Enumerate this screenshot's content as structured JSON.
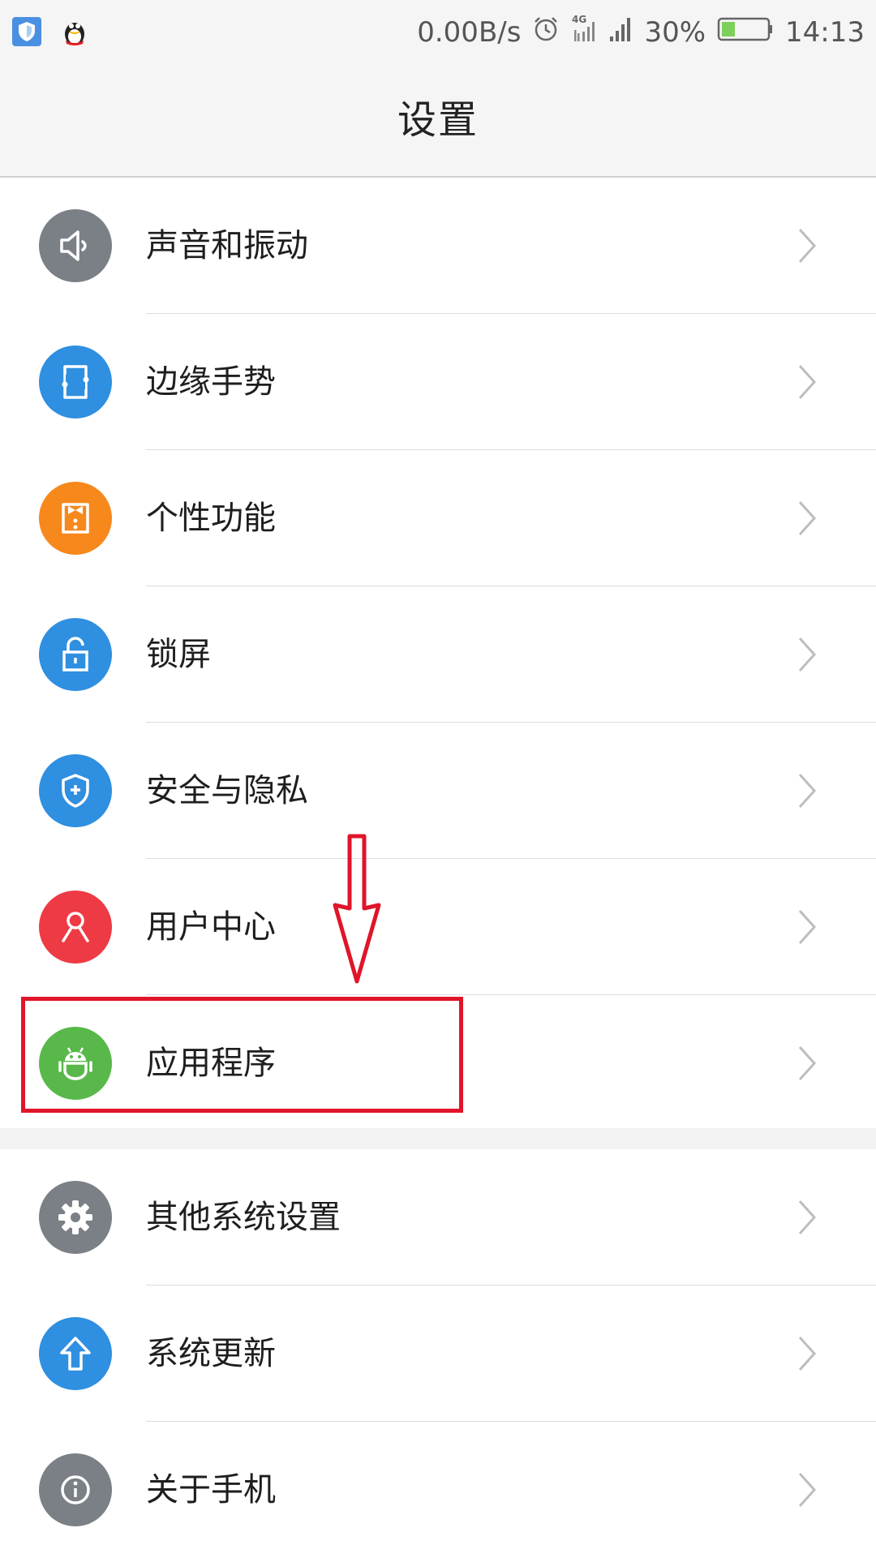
{
  "status_bar": {
    "net_speed": "0.00B/s",
    "network": "4G",
    "battery_percent": "30%",
    "battery_level": 0.3,
    "time": "14:13",
    "left_icons": [
      "shield-app-icon",
      "qq-penguin-icon"
    ]
  },
  "header": {
    "title": "设置"
  },
  "groups": [
    {
      "items": [
        {
          "label": "声音和振动",
          "icon": "speaker-icon",
          "color": "#7b7f86"
        },
        {
          "label": "边缘手势",
          "icon": "edge-gesture-icon",
          "color": "#2f8fe0"
        },
        {
          "label": "个性功能",
          "icon": "bowtie-icon",
          "color": "#f7881c"
        },
        {
          "label": "锁屏",
          "icon": "lock-icon",
          "color": "#2f8fe0"
        },
        {
          "label": "安全与隐私",
          "icon": "shield-icon",
          "color": "#2f8fe0"
        },
        {
          "label": "用户中心",
          "icon": "user-icon",
          "color": "#ee3a44"
        },
        {
          "label": "应用程序",
          "icon": "android-icon",
          "color": "#58b84a"
        }
      ]
    },
    {
      "items": [
        {
          "label": "其他系统设置",
          "icon": "gear-icon",
          "color": "#7b7f86"
        },
        {
          "label": "系统更新",
          "icon": "arrow-up-icon",
          "color": "#2f8fe0"
        },
        {
          "label": "关于手机",
          "icon": "info-icon",
          "color": "#7b7f86"
        }
      ]
    }
  ],
  "annotation": {
    "color": "#e0152a",
    "highlighted_item": "应用程序"
  }
}
